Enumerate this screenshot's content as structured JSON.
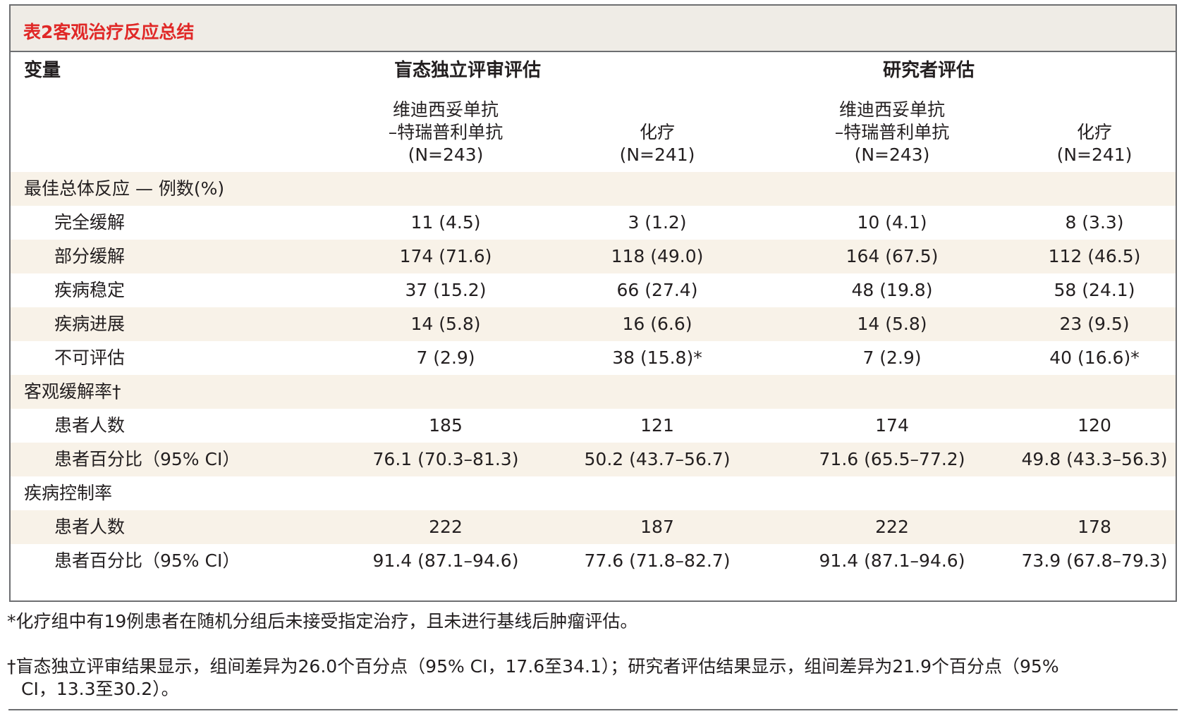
{
  "table": {
    "title": "表2客观治疗反应总结",
    "col_variable": "变量",
    "group_bicr": "盲态独立评审评估",
    "group_investigator": "研究者评估",
    "arm_combo_line1": "维迪西妥单抗",
    "arm_combo_line2": "–特瑞普利单抗",
    "arm_combo_n": "(N=243)",
    "arm_chemo": "化疗",
    "arm_chemo_n": "(N=241)",
    "rows": [
      {
        "label": "最佳总体反应 — 例数(%)",
        "values": [
          "",
          "",
          "",
          ""
        ]
      },
      {
        "label": "完全缓解",
        "values": [
          "11 (4.5)",
          "3 (1.2)",
          "10 (4.1)",
          "8 (3.3)"
        ]
      },
      {
        "label": "部分缓解",
        "values": [
          "174 (71.6)",
          "118 (49.0)",
          "164 (67.5)",
          "112 (46.5)"
        ]
      },
      {
        "label": "疾病稳定",
        "values": [
          "37 (15.2)",
          "66 (27.4)",
          "48 (19.8)",
          "58 (24.1)"
        ]
      },
      {
        "label": "疾病进展",
        "values": [
          "14 (5.8)",
          "16 (6.6)",
          "14 (5.8)",
          "23 (9.5)"
        ]
      },
      {
        "label": "不可评估",
        "values": [
          "7 (2.9)",
          "38 (15.8)*",
          "7 (2.9)",
          "40 (16.6)*"
        ]
      },
      {
        "label": "客观缓解率†",
        "values": [
          "",
          "",
          "",
          ""
        ]
      },
      {
        "label": "患者人数",
        "values": [
          "185",
          "121",
          "174",
          "120"
        ]
      },
      {
        "label": "患者百分比（95% CI）",
        "values": [
          "76.1 (70.3–81.3)",
          "50.2 (43.7–56.7)",
          "71.6 (65.5–77.2)",
          "49.8 (43.3–56.3)"
        ]
      },
      {
        "label": "疾病控制率",
        "values": [
          "",
          "",
          "",
          ""
        ]
      },
      {
        "label": "患者人数",
        "values": [
          "222",
          "187",
          "222",
          "178"
        ]
      },
      {
        "label": "患者百分比（95% CI）",
        "values": [
          "91.4 (87.1–94.6)",
          "77.6 (71.8–82.7)",
          "91.4 (87.1–94.6)",
          "73.9 (67.8–79.3)"
        ]
      }
    ]
  },
  "footnotes": {
    "note1": "*化疗组中有19例患者在随机分组后未接受指定治疗，且未进行基线后肿瘤评估。",
    "note2_line1": "†盲态独立评审结果显示，组间差异为26.0个百分点（95% CI，17.6至34.1）；研究者评估结果显示，组间差异为21.9个百分点（95%",
    "note2_line2": "CI，13.3至30.2）。"
  },
  "colors": {
    "title": "#e02827",
    "title_bg": "#efece6",
    "row_shade": "#f8f2e8",
    "border": "#6d6e71"
  }
}
